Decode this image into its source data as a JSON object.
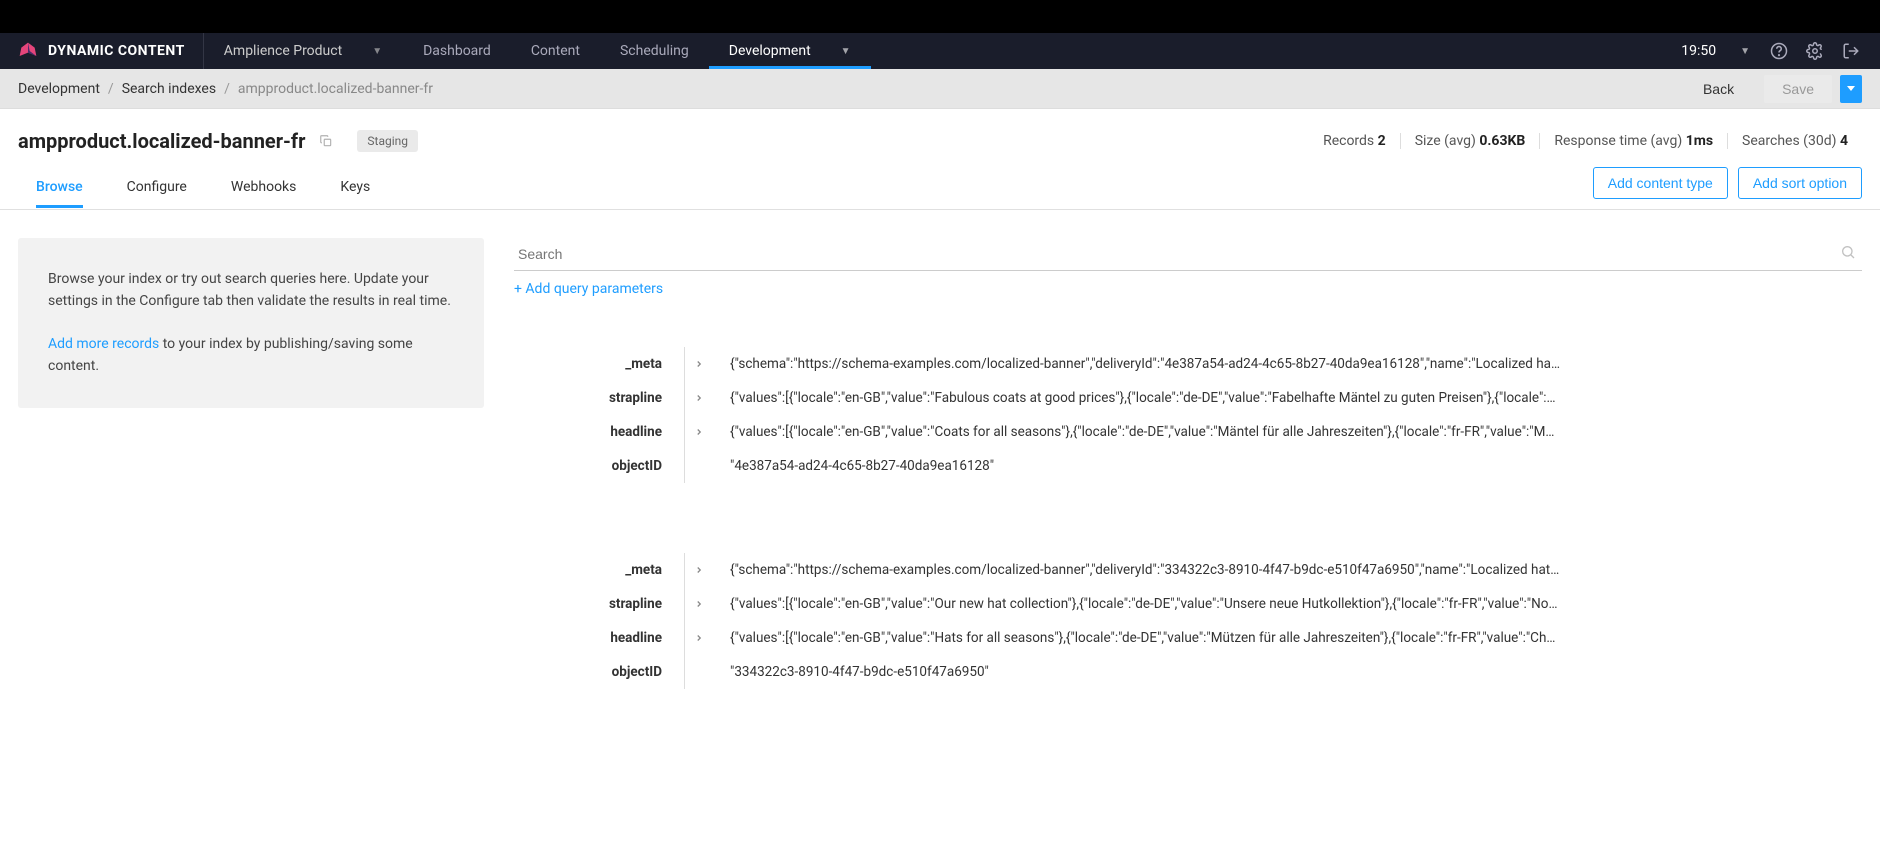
{
  "brand": "DYNAMIC CONTENT",
  "productDropdown": "Amplience Product",
  "navTabs": [
    {
      "label": "Dashboard",
      "active": false
    },
    {
      "label": "Content",
      "active": false
    },
    {
      "label": "Scheduling",
      "active": false
    },
    {
      "label": "Development",
      "active": true
    }
  ],
  "time": "19:50",
  "breadcrumb": {
    "dev": "Development",
    "search": "Search indexes",
    "current": "ampproduct.localized-banner-fr"
  },
  "buttons": {
    "back": "Back",
    "save": "Save",
    "addContentType": "Add content type",
    "addSortOption": "Add sort option"
  },
  "page": {
    "title": "ampproduct.localized-banner-fr",
    "badge": "Staging"
  },
  "stats": {
    "recordsLabel": "Records ",
    "recordsValue": "2",
    "sizeLabel": "Size (avg) ",
    "sizeValue": "0.63KB",
    "responseLabel": "Response time (avg) ",
    "responseValue": "1ms",
    "searchesLabel": "Searches (30d) ",
    "searchesValue": "4"
  },
  "pageTabs": {
    "browse": "Browse",
    "configure": "Configure",
    "webhooks": "Webhooks",
    "keys": "Keys"
  },
  "info": {
    "text": "Browse your index or try out search queries here. Update your settings in the Configure tab then validate the results in real time.",
    "link": "Add more records",
    "suffix": " to your index by publishing/saving some content."
  },
  "search": {
    "placeholder": "Search"
  },
  "addParamsLabel": "+ Add query parameters",
  "records": [
    {
      "rows": [
        {
          "key": "_meta",
          "expandable": true,
          "value": "{\"schema\":\"https://schema-examples.com/localized-banner\",\"deliveryId\":\"4e387a54-ad24-4c65-8b27-40da9ea16128\",\"name\":\"Localized ha…"
        },
        {
          "key": "strapline",
          "expandable": true,
          "value": "{\"values\":[{\"locale\":\"en-GB\",\"value\":\"Fabulous coats at good prices\"},{\"locale\":\"de-DE\",\"value\":\"Fabelhafte Mäntel zu guten Preisen\"},{\"locale\":…"
        },
        {
          "key": "headline",
          "expandable": true,
          "value": "{\"values\":[{\"locale\":\"en-GB\",\"value\":\"Coats for all seasons\"},{\"locale\":\"de-DE\",\"value\":\"Mäntel für alle Jahreszeiten\"},{\"locale\":\"fr-FR\",\"value\":\"M…"
        },
        {
          "key": "objectID",
          "expandable": false,
          "value": "\"4e387a54-ad24-4c65-8b27-40da9ea16128\""
        }
      ]
    },
    {
      "rows": [
        {
          "key": "_meta",
          "expandable": true,
          "value": "{\"schema\":\"https://schema-examples.com/localized-banner\",\"deliveryId\":\"334322c3-8910-4f47-b9dc-e510f47a6950\",\"name\":\"Localized hat…"
        },
        {
          "key": "strapline",
          "expandable": true,
          "value": "{\"values\":[{\"locale\":\"en-GB\",\"value\":\"Our new hat collection\"},{\"locale\":\"de-DE\",\"value\":\"Unsere neue Hutkollektion\"},{\"locale\":\"fr-FR\",\"value\":\"No…"
        },
        {
          "key": "headline",
          "expandable": true,
          "value": "{\"values\":[{\"locale\":\"en-GB\",\"value\":\"Hats for all seasons\"},{\"locale\":\"de-DE\",\"value\":\"Mützen für alle Jahreszeiten\"},{\"locale\":\"fr-FR\",\"value\":\"Ch…"
        },
        {
          "key": "objectID",
          "expandable": false,
          "value": "\"334322c3-8910-4f47-b9dc-e510f47a6950\""
        }
      ]
    }
  ]
}
